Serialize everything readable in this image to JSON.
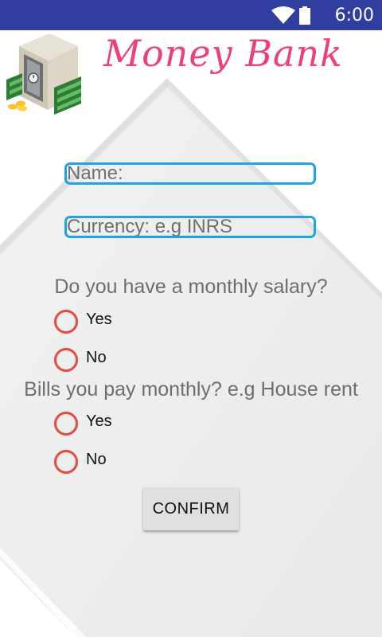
{
  "status_bar": {
    "time": "6:00",
    "icons": [
      "wifi-icon",
      "battery-icon"
    ],
    "background": "#303f9f"
  },
  "app": {
    "title": "Money Bank",
    "title_color": "#ec407a",
    "logo_icon": "money-safe-icon"
  },
  "form": {
    "name_placeholder": "Name:",
    "currency_placeholder": "Currency: e.g INRS",
    "field_border_color": "#1ea3e8",
    "salary_question": "Do you have a monthly salary?",
    "salary_options": [
      "Yes",
      "No"
    ],
    "bills_question": "Bills you pay monthly? e.g House rent",
    "bills_options": [
      "Yes",
      "No"
    ],
    "radio_color": "#e64a3c",
    "confirm_label": "CONFIRM"
  }
}
